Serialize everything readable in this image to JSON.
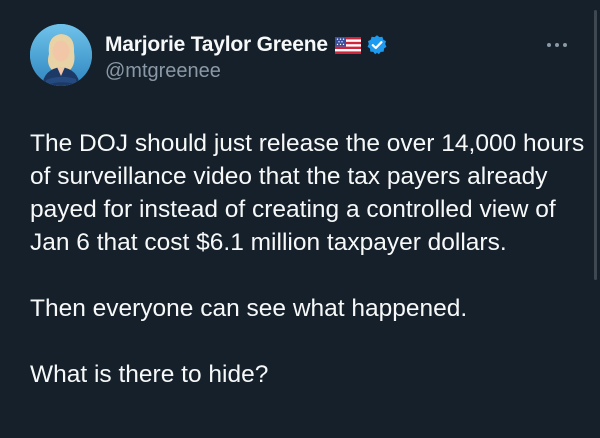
{
  "author": {
    "display_name": "Marjorie Taylor Greene",
    "handle": "@mtgreenee",
    "avatar_icon": "profile-photo",
    "flag_icon": "us-flag-icon",
    "verified_icon": "verified-badge-icon",
    "verified_color": "#1d9bf0"
  },
  "menu": {
    "icon": "more-options-icon"
  },
  "tweet": {
    "paragraphs": [
      "The DOJ should just release the over 14,000 hours of surveillance video that the tax payers already payed for instead of creating a controlled view of Jan 6 that cost $6.1 million taxpayer dollars.",
      "Then everyone can see what happened.",
      "What is there to hide?"
    ]
  },
  "colors": {
    "background": "#15202b",
    "text_primary": "#f7f9f9",
    "text_secondary": "#8b98a5"
  }
}
